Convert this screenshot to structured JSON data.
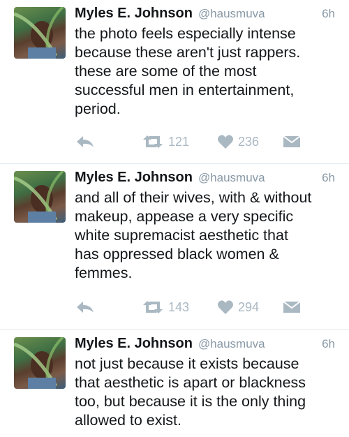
{
  "tweets": [
    {
      "name": "Myles E. Johnson",
      "handle": "@hausmuva",
      "time": "6h",
      "text": "the photo feels especially intense\nbecause these aren't just rappers.\nthese are some of the most\nsuccessful men in entertainment,\nperiod.",
      "retweets": "121",
      "likes": "236"
    },
    {
      "name": "Myles E. Johnson",
      "handle": "@hausmuva",
      "time": "6h",
      "text": "and all of their wives, with & without\nmakeup, appease a very specific\nwhite supremacist aesthetic that\nhas oppressed black women &\nfemmes.",
      "retweets": "143",
      "likes": "294"
    },
    {
      "name": "Myles E. Johnson",
      "handle": "@hausmuva",
      "time": "6h",
      "text": "not just because it exists because\nthat aesthetic is apart or blackness\ntoo, but because it is the only thing\nallowed to exist."
    }
  ],
  "icons": {
    "reply": "reply-icon",
    "retweet": "retweet-icon",
    "like": "heart-icon",
    "dm": "envelope-icon"
  },
  "colors": {
    "text": "#14171a",
    "muted": "#8899a6",
    "action": "#aab8c2",
    "divider": "#e1e8ed"
  }
}
